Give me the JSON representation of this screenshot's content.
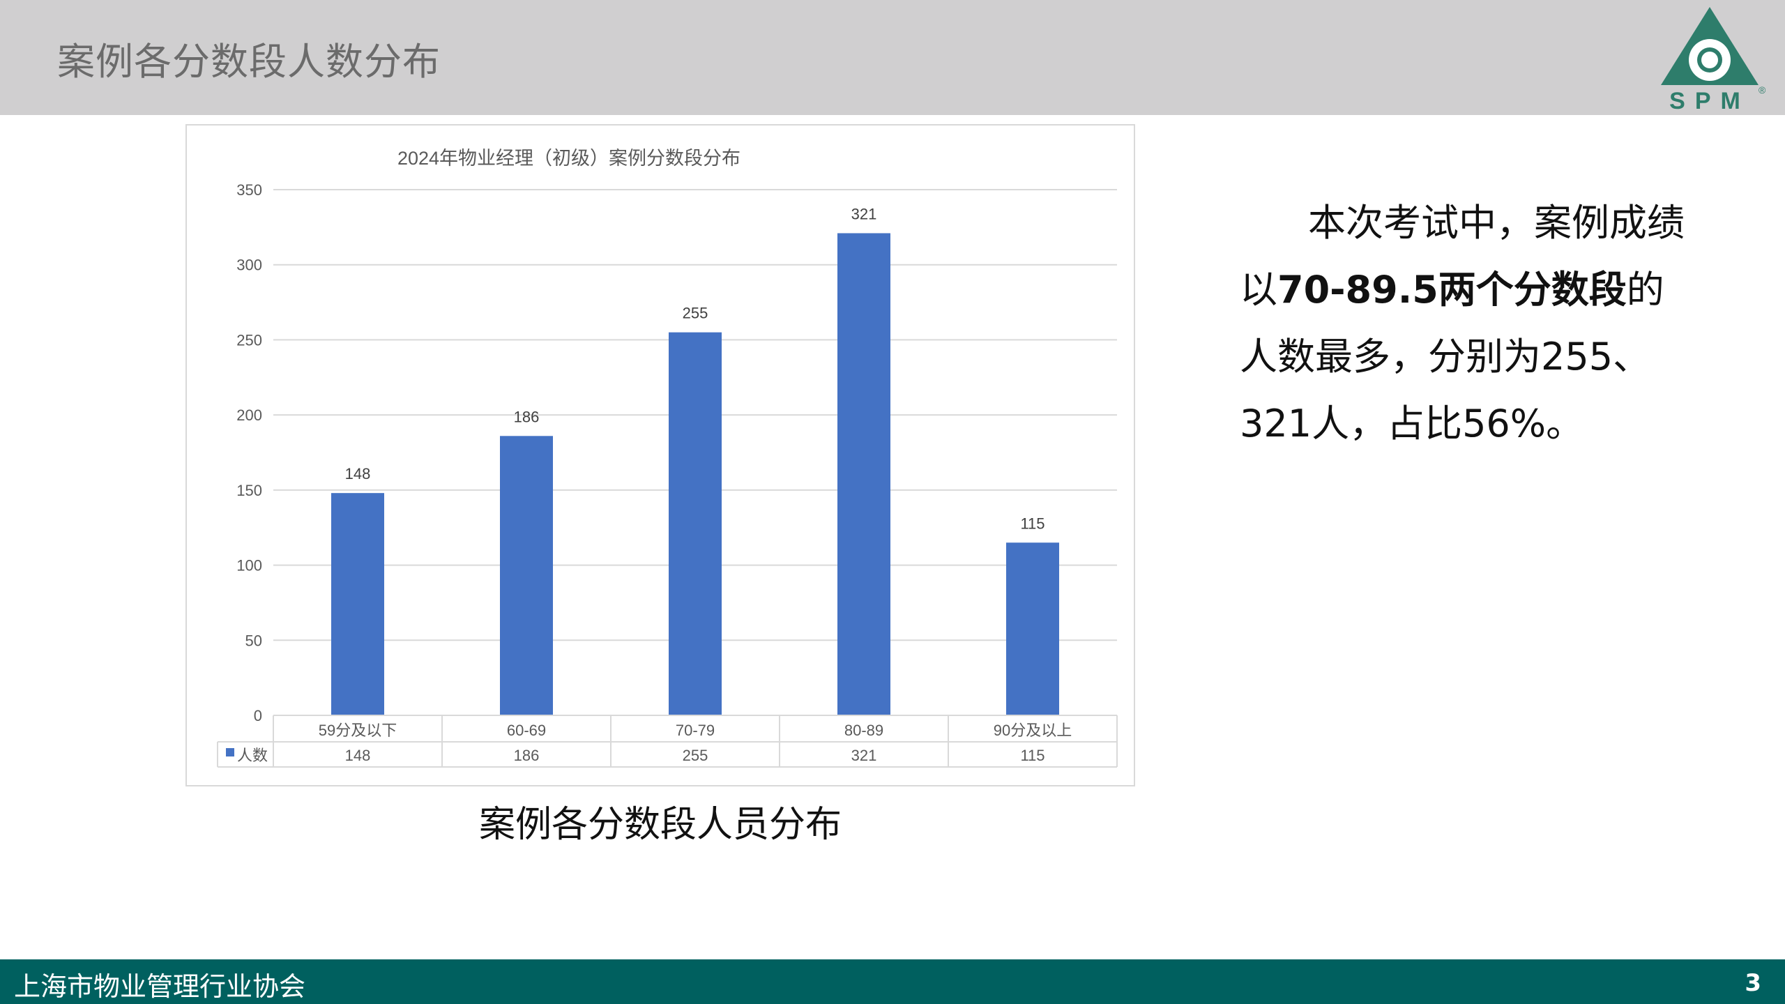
{
  "page_title": "案例各分数段人数分布",
  "logo_text": "SPM",
  "logo_mark": "®",
  "chart_data": {
    "type": "bar",
    "title": "2024年物业经理（初级）案例分数段分布",
    "categories": [
      "59分及以下",
      "60-69",
      "70-79",
      "80-89",
      "90分及以上"
    ],
    "series": [
      {
        "name": "人数",
        "values": [
          148,
          186,
          255,
          321,
          115
        ],
        "color": "#4472c4"
      }
    ],
    "ylim": [
      0,
      350
    ],
    "yticks": [
      0,
      50,
      100,
      150,
      200,
      250,
      300,
      350
    ],
    "data_labels": true,
    "data_table": true,
    "grid": true
  },
  "caption": "案例各分数段人员分布",
  "description": {
    "part1": "本次考试中，案例成绩以",
    "bold": "70-89.5两个分数段",
    "part2": "的人数最多，分别为255、321人，占比56%。"
  },
  "footer": {
    "org": "上海市物业管理行业协会",
    "page": "3"
  },
  "colors": {
    "header_bg": "#d0cfd0",
    "footer_bg": "#00605f",
    "bar": "#4472c4",
    "logo": "#2e7d6b"
  }
}
